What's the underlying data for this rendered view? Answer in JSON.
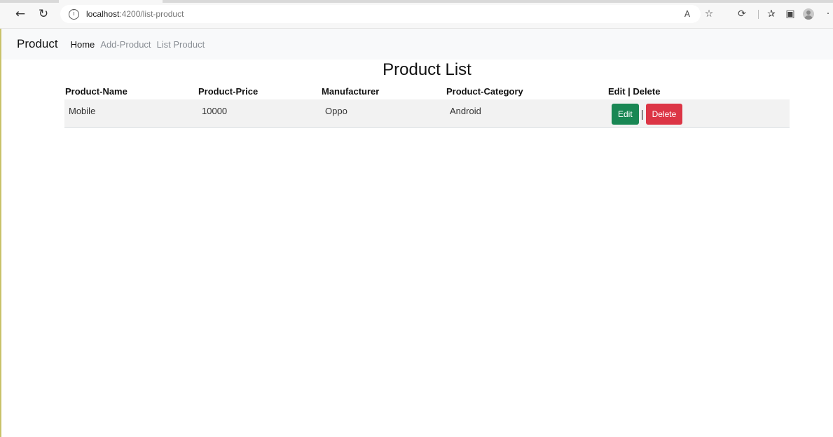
{
  "browser": {
    "url_host": "localhost",
    "url_path": ":4200/list-product",
    "icons": {
      "back": "←",
      "refresh": "↻",
      "info": "i",
      "read_aloud": "A",
      "favorite_add": "☆",
      "extensions": "⟳",
      "favorites": "✰",
      "collections": "▣",
      "more": "·"
    }
  },
  "navbar": {
    "brand": "Product",
    "links": [
      "Home",
      "Add-Product",
      "List Product"
    ]
  },
  "page": {
    "title": "Product List"
  },
  "table": {
    "headers": [
      "Product-Name",
      "Product-Price",
      "Manufacturer",
      "Product-Category",
      "Edit | Delete"
    ],
    "rows": [
      {
        "name": "Mobile",
        "price": "10000",
        "manufacturer": "Oppo",
        "category": "Android"
      }
    ],
    "edit_label": "Edit",
    "separator": "|",
    "delete_label": "Delete"
  },
  "colors": {
    "edit_button": "#198754",
    "delete_button": "#dc3545",
    "navbar_bg": "#f8f9fa",
    "row_bg": "#f2f2f2"
  }
}
